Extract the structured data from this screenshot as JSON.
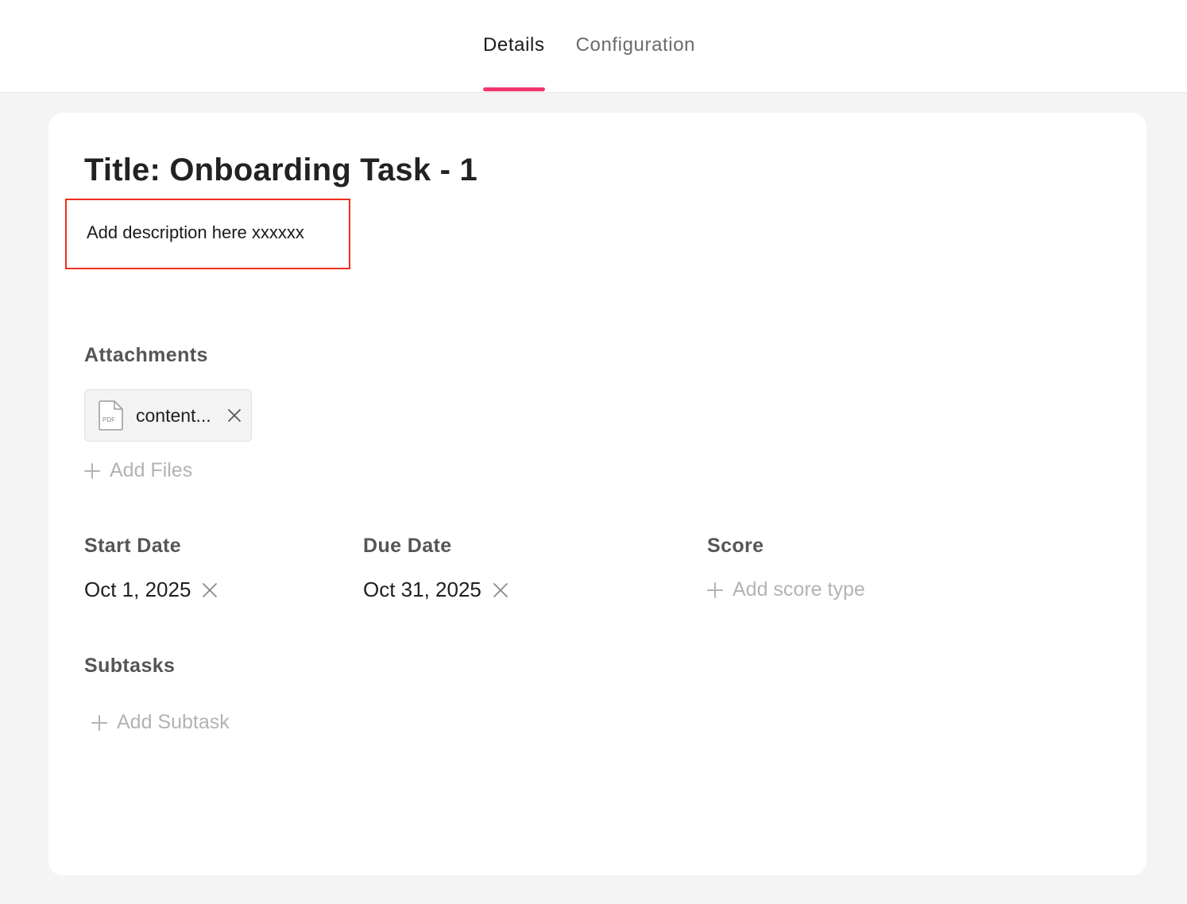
{
  "tabs": [
    {
      "label": "Details",
      "active": true
    },
    {
      "label": "Configuration",
      "active": false
    }
  ],
  "task": {
    "title": "Title: Onboarding Task - 1",
    "description": "Add description here xxxxxx"
  },
  "attachments": {
    "label": "Attachments",
    "files": [
      {
        "name": "content...",
        "type": "PDF",
        "icon": "pdf-file-icon"
      }
    ],
    "add_label": "Add Files"
  },
  "start_date": {
    "label": "Start Date",
    "value": "Oct 1, 2025"
  },
  "due_date": {
    "label": "Due Date",
    "value": "Oct 31, 2025"
  },
  "score": {
    "label": "Score",
    "add_label": "Add score type"
  },
  "subtasks": {
    "label": "Subtasks",
    "add_label": "Add Subtask"
  },
  "colors": {
    "accent": "#f0386b",
    "annotation": "#ee2f1d",
    "page_bg": "#f4f4f4",
    "muted": "#b3b3b3"
  }
}
